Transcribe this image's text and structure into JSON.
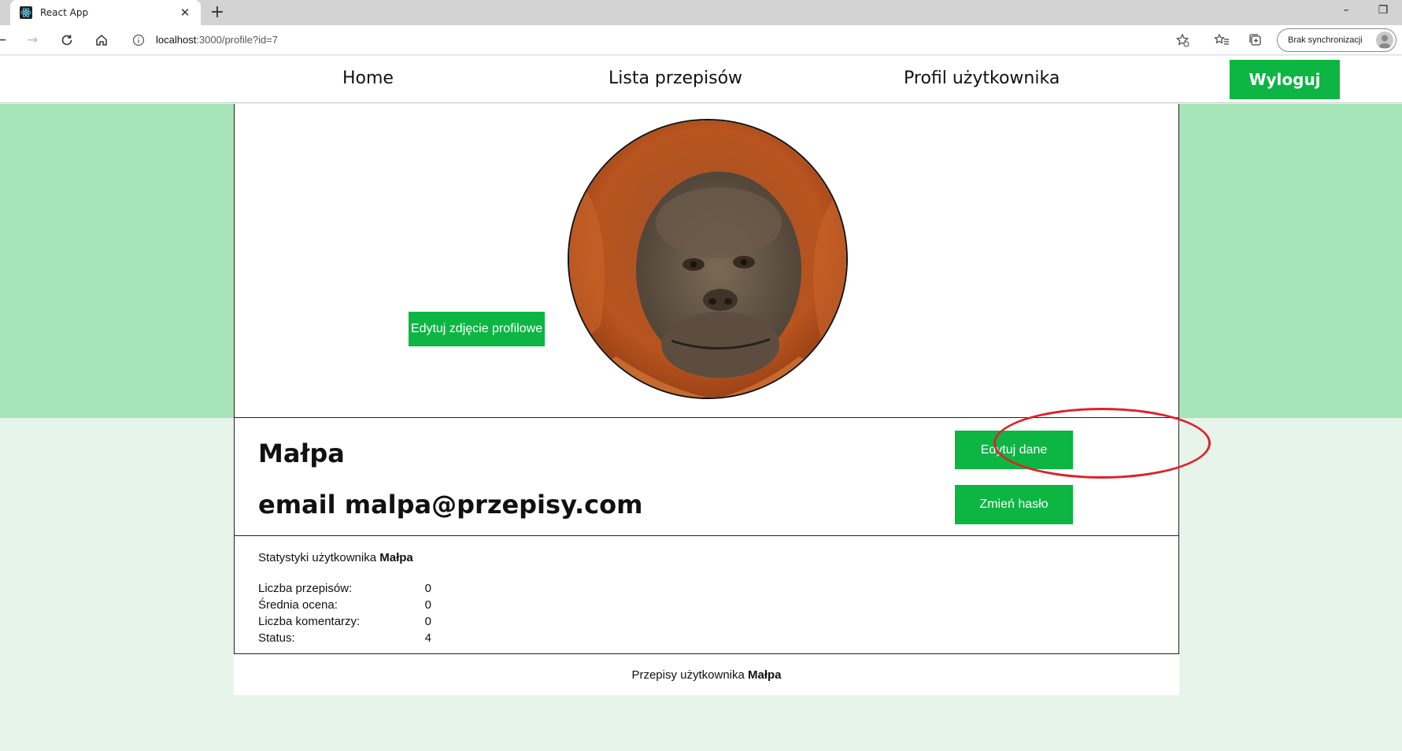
{
  "browser": {
    "tab_title": "React App",
    "url_host": "localhost",
    "url_rest": ":3000/profile?id=7",
    "sync_label": "Brak synchronizacji"
  },
  "nav": {
    "links": [
      "Home",
      "Lista przepisów",
      "Profil użytkownika"
    ],
    "logout_label": "Wyloguj"
  },
  "profile": {
    "edit_photo_label": "Edytuj zdjęcie profilowe",
    "name": "Małpa",
    "email_line": "email malpa@przepisy.com",
    "edit_data_label": "Edytuj dane",
    "change_password_label": "Zmień hasło"
  },
  "stats": {
    "heading_prefix": "Statystyki użytkownika",
    "heading_user": "Małpa",
    "rows": [
      {
        "label": "Liczba przepisów:",
        "value": "0"
      },
      {
        "label": "Średnia ocena:",
        "value": "0"
      },
      {
        "label": "Liczba komentarzy:",
        "value": "0"
      },
      {
        "label": "Status:",
        "value": "4"
      }
    ]
  },
  "recipes": {
    "prefix": "Przepisy użytkownika",
    "user": "Małpa"
  },
  "colors": {
    "accent_green": "#0db543",
    "band_green": "#a5e5b8",
    "page_bg": "#e7f4ea",
    "annotation_red": "#e0202a"
  },
  "icons": [
    "react-favicon",
    "close-icon",
    "plus-icon",
    "back-icon",
    "forward-icon",
    "reload-icon",
    "home-icon",
    "info-icon",
    "star-add-icon",
    "favorites-icon",
    "collections-icon",
    "profile-avatar-icon"
  ]
}
